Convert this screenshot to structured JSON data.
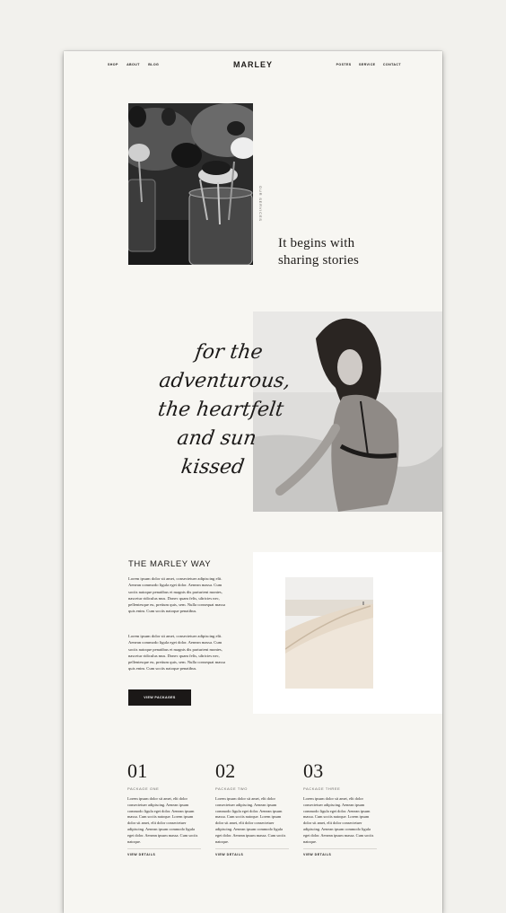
{
  "nav": {
    "left": [
      "SHOP",
      "ABOUT",
      "BLOG"
    ],
    "logo": "MARLEY",
    "right": [
      "POSTES",
      "SERVICE",
      "CONTACT"
    ]
  },
  "hero": {
    "services_label": "OUR SERVICES",
    "headline_line1": "It begins with",
    "headline_line2": "sharing stories"
  },
  "script": {
    "lines": [
      "for the",
      "adventurous,",
      "the heartfelt",
      "and sun",
      "kissed"
    ]
  },
  "marley_way": {
    "title": "THE MARLEY WAY",
    "paragraph1": "Lorem ipsum dolor sit amet, consectetuer adipiscing elit. Aenean commodo ligula eget dolor. Aenean massa. Cum sociis natoque penatibus et magnis dis parturient montes, nascetur ridiculus mus. Donec quam felis, ultricies nec, pellentesque eu, pretium quis, sem. Nulla consequat massa quis enim. Cum sociis natoque penatibus.",
    "paragraph2": "Lorem ipsum dolor sit amet, consectetuer adipiscing elit. Aenean commodo ligula eget dolor. Aenean massa. Cum sociis natoque penatibus et magnis dis parturient montes, nascetur ridiculus mus. Donec quam felis, ultricies nec, pellentesque eu, pretium quis, sem. Nulla consequat massa quis enim. Cum sociis natoque penatibus.",
    "button": "VIEW PACKAGES"
  },
  "packages": [
    {
      "number": "01",
      "label": "PACKAGE ONE",
      "text": "Lorem ipsum dolor sit amet, elit dolor consectetuer adipiscing. Aenean ipsum commodo ligula eget dolor. Aenean ipsum massa. Cum sociis natoque. Lorem ipsum dolor sit amet, elit dolor consectetuer adipiscing. Aenean ipsum commodo ligula eget dolor. Aenean ipsum massa. Cum sociis natoque.",
      "link": "VIEW DETAILS"
    },
    {
      "number": "02",
      "label": "PACKAGE TWO",
      "text": "Lorem ipsum dolor sit amet, elit dolor consectetuer adipiscing. Aenean ipsum commodo ligula eget dolor. Aenean ipsum massa. Cum sociis natoque. Lorem ipsum dolor sit amet, elit dolor consectetuer adipiscing. Aenean ipsum commodo ligula eget dolor. Aenean ipsum massa. Cum sociis natoque.",
      "link": "VIEW DETAILS"
    },
    {
      "number": "03",
      "label": "PACKAGE THREE",
      "text": "Lorem ipsum dolor sit amet, elit dolor consectetuer adipiscing. Aenean ipsum commodo ligula eget dolor. Aenean ipsum massa. Cum sociis natoque. Lorem ipsum dolor sit amet, elit dolor consectetuer adipiscing. Aenean ipsum commodo ligula eget dolor. Aenean ipsum massa. Cum sociis natoque.",
      "link": "VIEW DETAILS"
    }
  ]
}
